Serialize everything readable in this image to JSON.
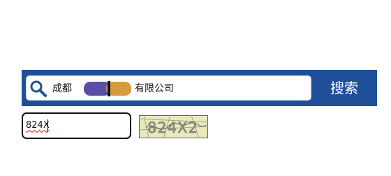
{
  "search": {
    "query_text": "成都▒▒▒▒▒▒有限公司",
    "query_prefix": "成都",
    "query_suffix": "有限公司",
    "button_label": "搜索"
  },
  "captcha": {
    "input_value": "824X",
    "image_text": "824X2"
  },
  "colors": {
    "bar": "#1e4f98",
    "button_text": "#ffffff",
    "redaction_purple": "#5a4fa8",
    "redaction_orange": "#d79a3c"
  },
  "icons": {
    "search": "search-icon"
  }
}
